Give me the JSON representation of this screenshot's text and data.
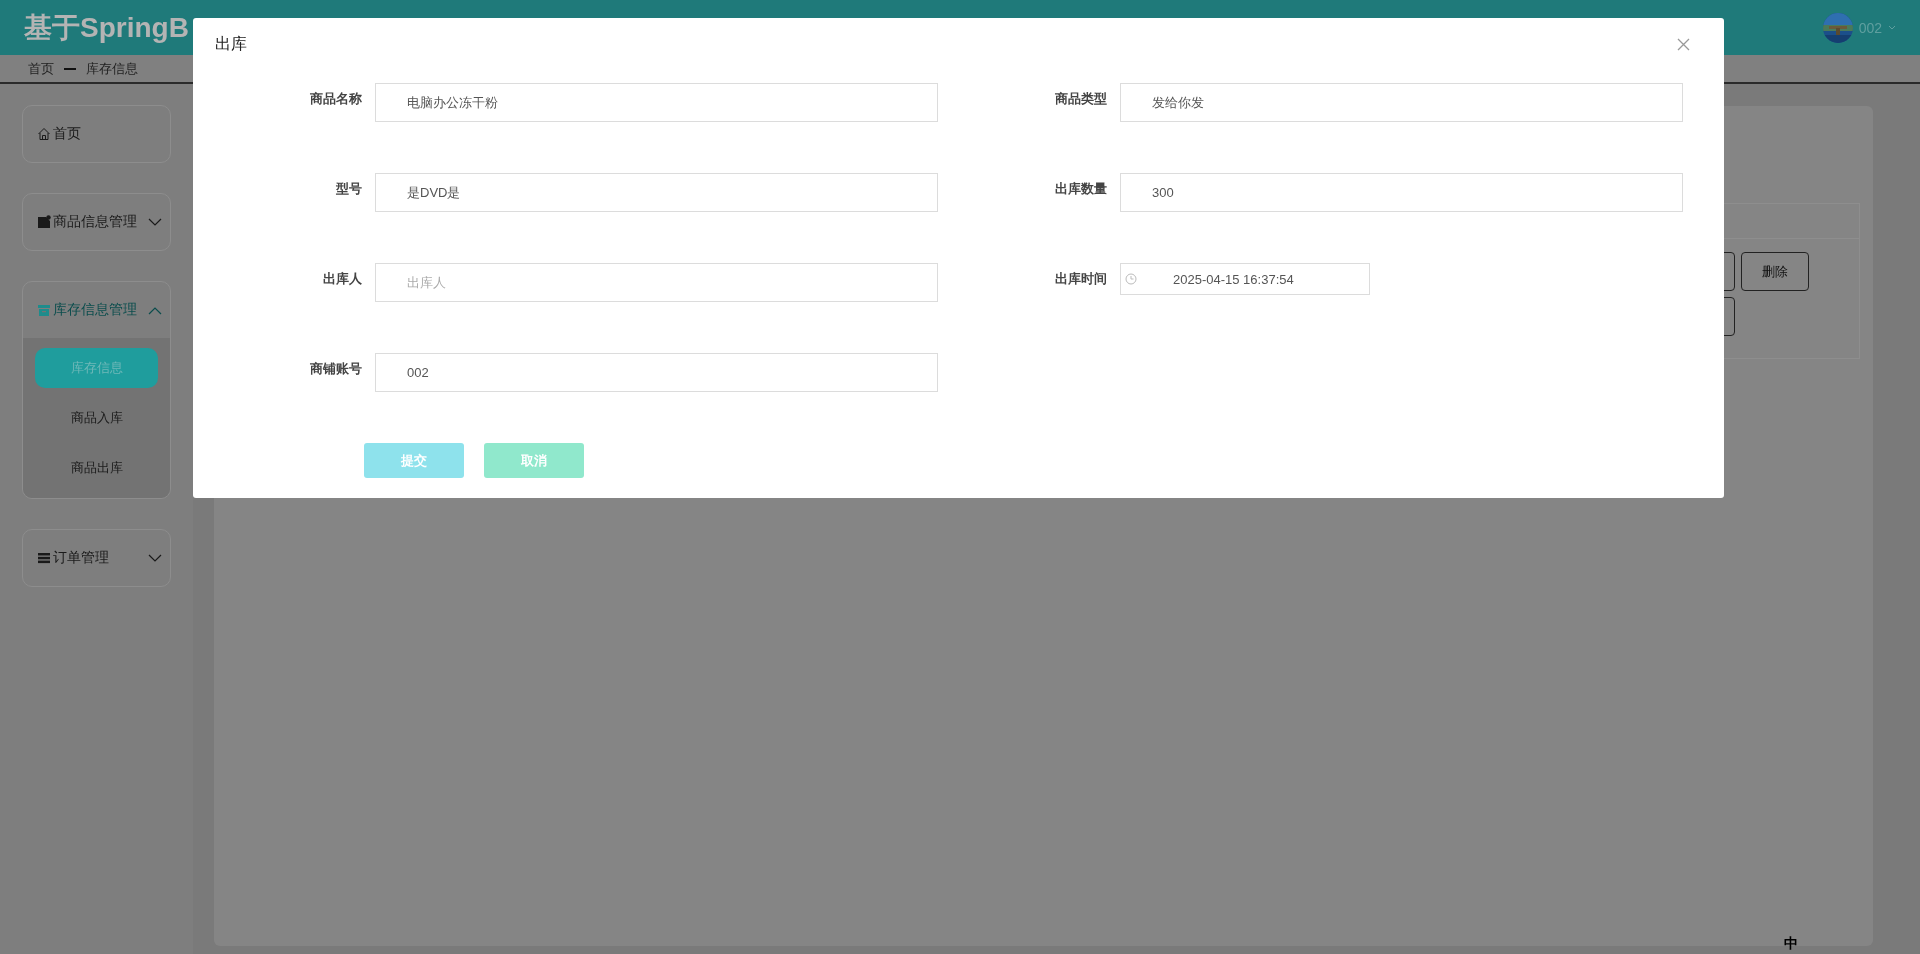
{
  "header": {
    "title": "基于SpringB",
    "user": "002"
  },
  "breadcrumb": [
    "首页",
    "库存信息"
  ],
  "sidebar": {
    "items": [
      {
        "label": "首页",
        "kind": "link"
      },
      {
        "label": "商品信息管理",
        "kind": "group",
        "expanded": false
      },
      {
        "label": "库存信息管理",
        "kind": "group",
        "expanded": true,
        "children": [
          {
            "label": "库存信息",
            "selected": true
          },
          {
            "label": "商品入库",
            "selected": false
          },
          {
            "label": "商品出库",
            "selected": false
          }
        ]
      },
      {
        "label": "订单管理",
        "kind": "group",
        "expanded": false
      }
    ]
  },
  "table": {
    "action_buttons": [
      "删除"
    ]
  },
  "dialog": {
    "title": "出库",
    "fields": [
      {
        "label": "商品名称",
        "kind": "text",
        "value": "电脑办公冻干粉"
      },
      {
        "label": "商品类型",
        "kind": "text",
        "value": "发给你发"
      },
      {
        "label": "型号",
        "kind": "text",
        "value": "是DVD是"
      },
      {
        "label": "出库数量",
        "kind": "text",
        "value": "300"
      },
      {
        "label": "出库人",
        "kind": "text",
        "placeholder": "出库人"
      },
      {
        "label": "出库时间",
        "kind": "datetime",
        "value": "2025-04-15 16:37:54"
      },
      {
        "label": "商铺账号",
        "kind": "text",
        "value": "002"
      }
    ],
    "buttons": [
      {
        "label": "提交",
        "kind": "primary"
      },
      {
        "label": "取消",
        "kind": "secondary"
      }
    ]
  },
  "ime": "中"
}
